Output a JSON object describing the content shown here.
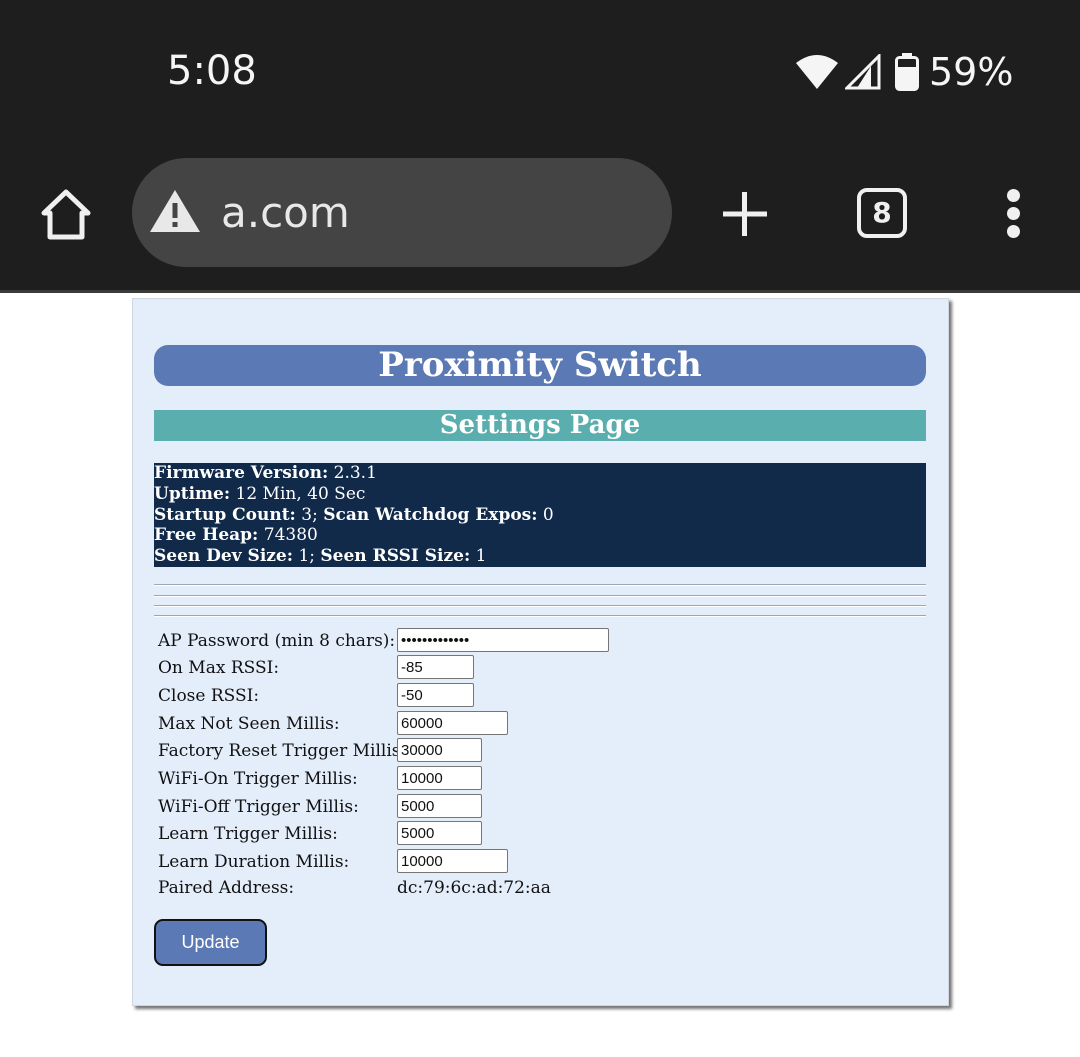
{
  "status_bar": {
    "time": "5:08",
    "battery_percent": "59%",
    "icons": [
      "wifi-icon",
      "cell-signal-icon",
      "battery-icon"
    ]
  },
  "browser": {
    "url": "a.com",
    "tab_count": "8",
    "security_icon": "warning-triangle-icon",
    "buttons": [
      "home-icon",
      "new-tab-icon",
      "tab-switcher",
      "more-menu-icon"
    ]
  },
  "page": {
    "title": "Proximity Switch",
    "subtitle": "Settings Page",
    "info": {
      "firmware_label": "Firmware Version:",
      "firmware_value": "2.3.1",
      "uptime_label": "Uptime:",
      "uptime_value": "12 Min, 40 Sec",
      "startup_label": "Startup Count:",
      "startup_value": "3;",
      "watchdog_label": "Scan Watchdog Expos:",
      "watchdog_value": "0",
      "heap_label": "Free Heap:",
      "heap_value": "74380",
      "seen_dev_label": "Seen Dev Size:",
      "seen_dev_value": "1;",
      "seen_rssi_label": "Seen RSSI Size:",
      "seen_rssi_value": "1"
    },
    "form": {
      "ap_password_label": "AP Password (min 8 chars):",
      "ap_password_value": "•••••••••••••",
      "on_max_rssi_label": "On Max RSSI:",
      "on_max_rssi_value": "-85",
      "close_rssi_label": "Close RSSI:",
      "close_rssi_value": "-50",
      "max_not_seen_label": "Max Not Seen Millis:",
      "max_not_seen_value": "60000",
      "factory_reset_label": "Factory Reset Trigger Millis:",
      "factory_reset_value": "30000",
      "wifi_on_label": "WiFi-On Trigger Millis:",
      "wifi_on_value": "10000",
      "wifi_off_label": "WiFi-Off Trigger Millis:",
      "wifi_off_value": "5000",
      "learn_trigger_label": "Learn Trigger Millis:",
      "learn_trigger_value": "5000",
      "learn_duration_label": "Learn Duration Millis:",
      "learn_duration_value": "10000",
      "paired_address_label": "Paired Address:",
      "paired_address_value": "dc:79:6c:ad:72:aa"
    },
    "update_label": "Update"
  },
  "colors": {
    "title_bg": "#5b79b4",
    "subtitle_bg": "#5aaeae",
    "info_bg": "#112a4a",
    "card_bg": "#e4edfa",
    "chrome_bg": "#1e1e1e",
    "omnibox_bg": "#444444"
  }
}
